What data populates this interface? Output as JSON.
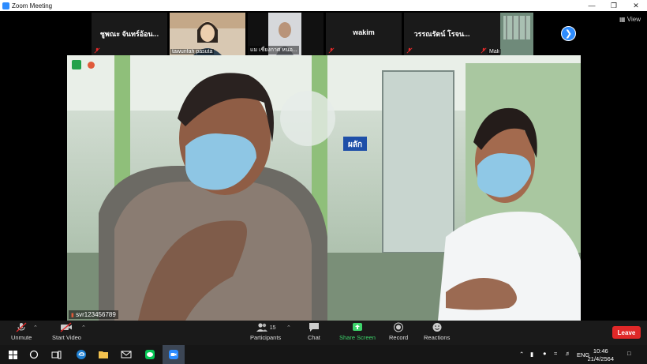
{
  "window": {
    "title": "Zoom Meeting"
  },
  "participants_strip": [
    {
      "name": "ชูพณะ จันทร์อ้อน...",
      "has_video": false,
      "muted": true
    },
    {
      "name": "tawunfah pasuta",
      "has_video": true,
      "muted": false
    },
    {
      "name": "แม เชี่ยงกาศ หนอ...",
      "has_video": true,
      "muted": false
    },
    {
      "name": "wakim",
      "has_video": false,
      "muted": true
    },
    {
      "name": "วรรณรัตน์ โรจน...",
      "has_video": false,
      "muted": true
    },
    {
      "name": "Mali",
      "has_video": true,
      "muted": true
    }
  ],
  "view_button": {
    "label": "View"
  },
  "main_video": {
    "speaker_name": "svr123456789",
    "sign_text": "ผลัก"
  },
  "toolbar": {
    "unmute": "Unmute",
    "start_video": "Start Video",
    "participants": "Participants",
    "participants_count": "15",
    "chat": "Chat",
    "share_screen": "Share Screen",
    "record": "Record",
    "reactions": "Reactions",
    "leave": "Leave"
  },
  "taskbar": {
    "language": "ENG",
    "time": "10:46",
    "date": "21/4/2564"
  },
  "colors": {
    "accent": "#2d8cff",
    "leave": "#e02828",
    "share": "#3dd46b"
  }
}
